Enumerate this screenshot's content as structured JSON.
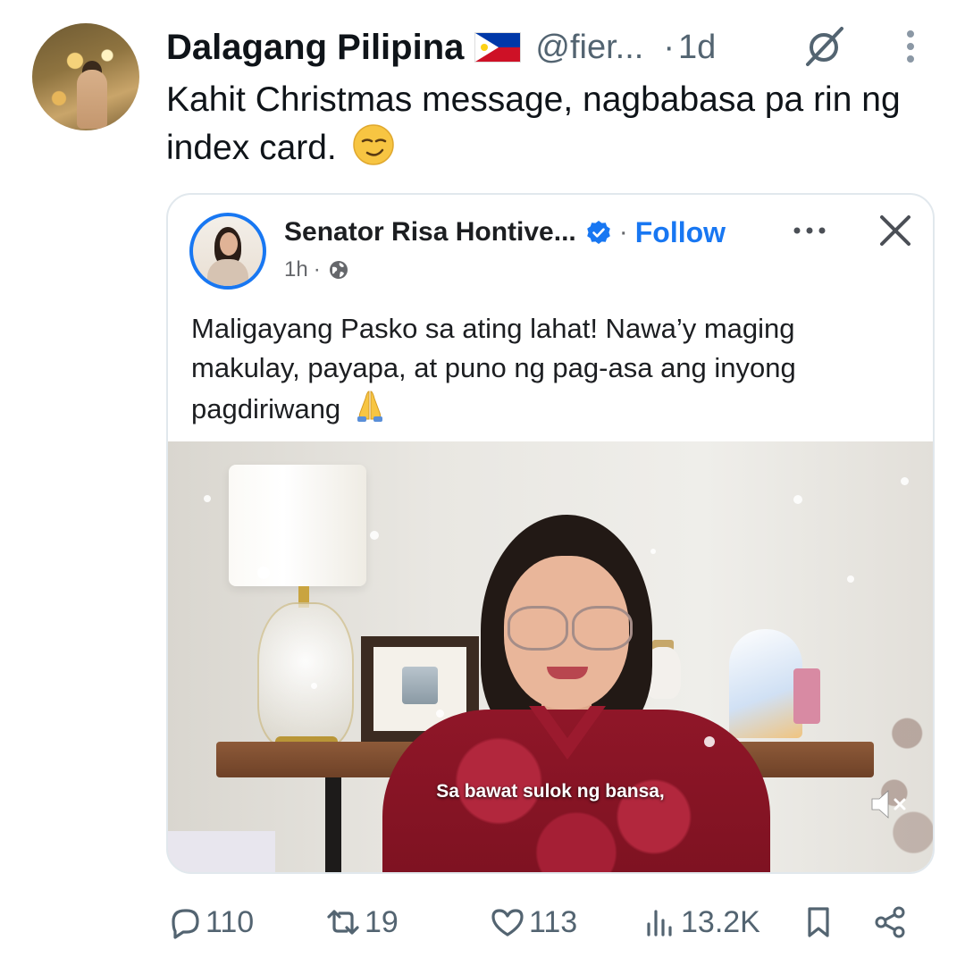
{
  "tweet": {
    "author_name": "Dalagang Pilipina",
    "handle": "@fier...",
    "separator": "·",
    "time": "1d",
    "text": "Kahit Christmas message, nagbabasa pa rin ng index card.",
    "emoji": "smirking-face",
    "icons": {
      "flag": "philippines-flag-icon",
      "grok": "slash-circle-icon",
      "more": "kebab-menu-icon"
    }
  },
  "embed": {
    "page_name": "Senator Risa Hontive...",
    "verified": true,
    "separator": "·",
    "follow_label": "Follow",
    "timestamp": "1h",
    "meta_separator": "·",
    "audience_icon": "globe-icon",
    "text": "Maligayang Pasko sa ating lahat! Nawa’y maging makulay, payapa, at puno ng pag-asa ang inyong pagdiriwang",
    "text_emoji": "folded-hands",
    "video": {
      "caption": "Sa bawat sulok ng bansa,",
      "muted": true
    },
    "accent_color": "#1877f2"
  },
  "actions": {
    "replies": "110",
    "reposts": "19",
    "likes": "113",
    "views": "13.2K"
  },
  "colors": {
    "text_primary": "#0f1419",
    "text_secondary": "#536471",
    "card_border": "#e1e8ed"
  }
}
